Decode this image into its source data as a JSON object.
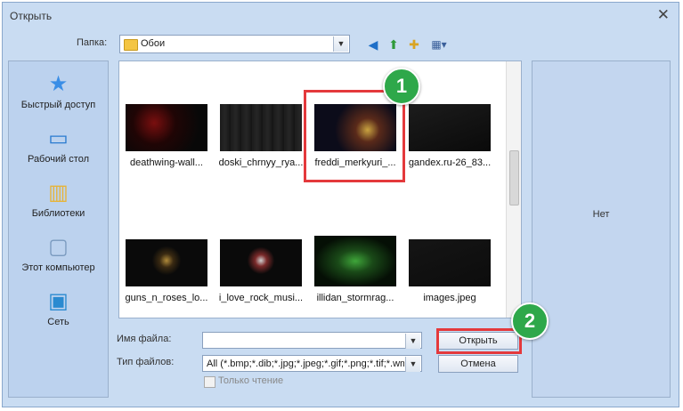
{
  "window": {
    "title": "Открыть",
    "close_glyph": "✕"
  },
  "folder": {
    "label": "Папка:",
    "current": "Обои"
  },
  "toolbar": {
    "back_glyph": "◀",
    "up_glyph": "⬆",
    "new_folder_glyph": "✚",
    "view_glyph": "▦▾"
  },
  "places": [
    {
      "label": "Быстрый доступ",
      "icon": "star-icon",
      "glyph": "★",
      "color": "#3a8ee6"
    },
    {
      "label": "Рабочий стол",
      "icon": "desktop-icon",
      "glyph": "▭",
      "color": "#2a7bd0"
    },
    {
      "label": "Библиотеки",
      "icon": "library-icon",
      "glyph": "▥",
      "color": "#e6b43a"
    },
    {
      "label": "Этот компьютер",
      "icon": "computer-icon",
      "glyph": "▢",
      "color": "#7a9abf"
    },
    {
      "label": "Сеть",
      "icon": "network-icon",
      "glyph": "▣",
      "color": "#2a8ad0"
    }
  ],
  "files": [
    {
      "name": "deathwing-wall...",
      "accent": "#7a0f0f"
    },
    {
      "name": "doski_chrnyy_rya...",
      "accent": "#2a2a2a"
    },
    {
      "name": "freddi_merkyuri_...",
      "accent": "#c9a340"
    },
    {
      "name": "gandex.ru-26_83...",
      "accent": "#1c1c1c"
    },
    {
      "name": "guns_n_roses_lo...",
      "accent": "#b08a3a"
    },
    {
      "name": "i_love_rock_musi...",
      "accent": "#d0d0d0"
    },
    {
      "name": "illidan_stormrag...",
      "accent": "#3fa63a"
    },
    {
      "name": "images.jpeg",
      "accent": "#121212"
    }
  ],
  "preview": {
    "text": "Нет"
  },
  "filename": {
    "label": "Имя файла:",
    "value": ""
  },
  "filetype": {
    "label": "Тип файлов:",
    "value": "All (*.bmp;*.dib;*.jpg;*.jpeg;*.gif;*.png;*.tif;*.wmf;*.emf)"
  },
  "buttons": {
    "open": "Открыть",
    "cancel": "Отмена"
  },
  "readonly": {
    "label": "Только чтение"
  },
  "annotations": {
    "step1": "1",
    "step2": "2",
    "highlight_color": "#e4393c",
    "badge_color": "#2ea84a"
  }
}
